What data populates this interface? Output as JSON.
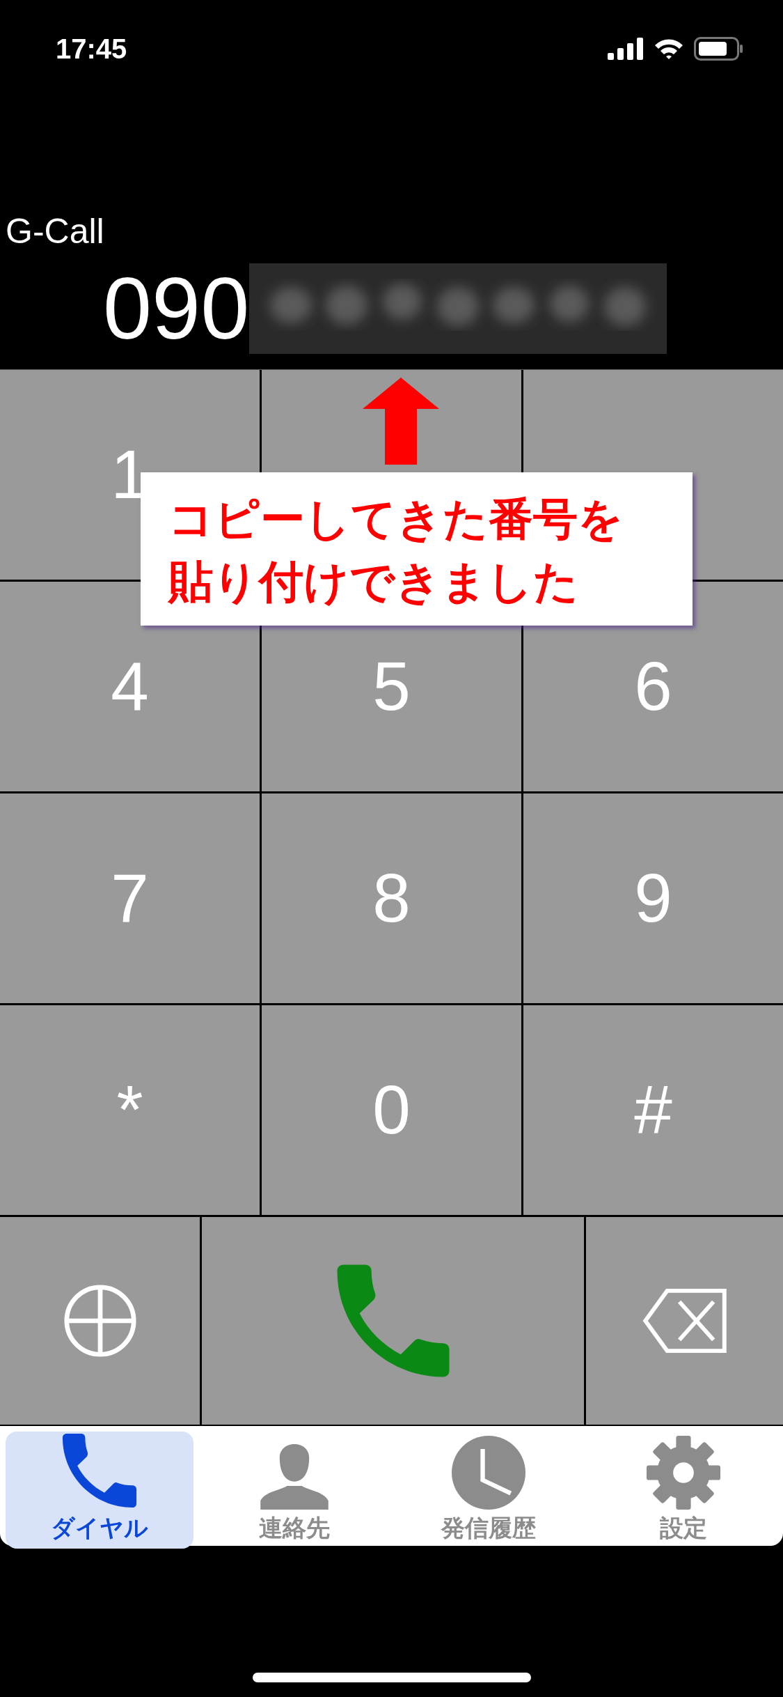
{
  "status_bar": {
    "time": "17:45"
  },
  "header": {
    "app_name": "G-Call",
    "number": "090"
  },
  "keypad": [
    {
      "kind": "digit",
      "label": "1"
    },
    {
      "kind": "covered"
    },
    {
      "kind": "covered"
    },
    {
      "kind": "digit",
      "label": "4"
    },
    {
      "kind": "digit",
      "label": "5"
    },
    {
      "kind": "digit",
      "label": "6"
    },
    {
      "kind": "digit",
      "label": "7"
    },
    {
      "kind": "digit",
      "label": "8"
    },
    {
      "kind": "digit",
      "label": "9"
    },
    {
      "kind": "digit",
      "label": "*"
    },
    {
      "kind": "digit",
      "label": "0"
    },
    {
      "kind": "digit",
      "label": "#"
    }
  ],
  "actions": [
    {
      "kind": "add"
    },
    {
      "kind": "call"
    },
    {
      "kind": "delete"
    }
  ],
  "tabs": [
    {
      "label": "ダイヤル",
      "kind": "phone",
      "selected": true
    },
    {
      "label": "連絡先",
      "kind": "person",
      "selected": false
    },
    {
      "label": "発信履歴",
      "kind": "clock",
      "selected": false
    },
    {
      "label": "設定",
      "kind": "gear",
      "selected": false
    }
  ],
  "callout": {
    "lines": [
      "コピーしてきた番号を",
      "貼り付けできました"
    ]
  }
}
